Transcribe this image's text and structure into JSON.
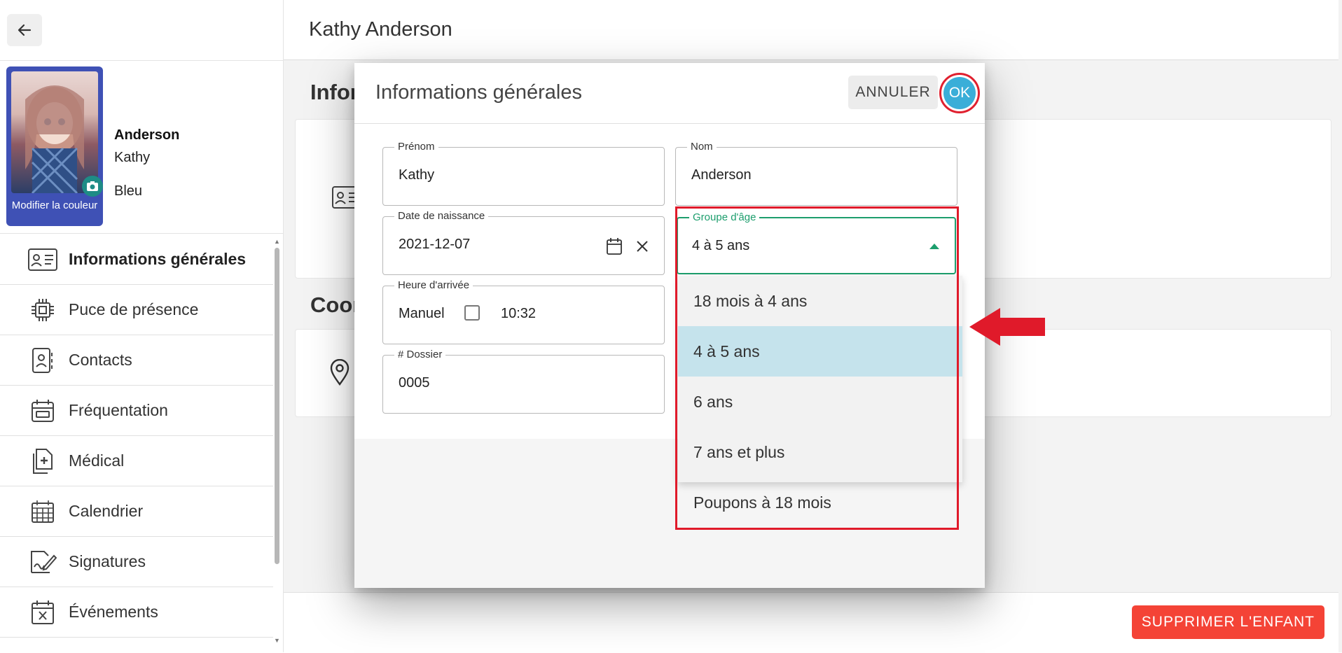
{
  "header": {
    "title": "Kathy Anderson"
  },
  "profile": {
    "last_name": "Anderson",
    "first_name": "Kathy",
    "color": "Bleu",
    "avatar_caption": "Modifier la couleur"
  },
  "sidebar": {
    "items": [
      {
        "label": "Informations générales",
        "icon": "id-card-icon",
        "active": true
      },
      {
        "label": "Puce de présence",
        "icon": "chip-icon",
        "active": false
      },
      {
        "label": "Contacts",
        "icon": "contact-book-icon",
        "active": false
      },
      {
        "label": "Fréquentation",
        "icon": "calendar-frame-icon",
        "active": false
      },
      {
        "label": "Médical",
        "icon": "medical-doc-icon",
        "active": false
      },
      {
        "label": "Calendrier",
        "icon": "calendar-grid-icon",
        "active": false
      },
      {
        "label": "Signatures",
        "icon": "signature-icon",
        "active": false
      },
      {
        "label": "Événements",
        "icon": "event-cancel-icon",
        "active": false
      }
    ]
  },
  "main": {
    "section1": "Infor",
    "section2": "Coor",
    "delete_label": "SUPPRIMER L'ENFANT"
  },
  "modal": {
    "title": "Informations générales",
    "cancel_label": "ANNULER",
    "ok_label": "OK",
    "fields": {
      "prenom": {
        "label": "Prénom",
        "value": "Kathy"
      },
      "nom": {
        "label": "Nom",
        "value": "Anderson"
      },
      "naissance": {
        "label": "Date de naissance",
        "value": "2021-12-07"
      },
      "groupe": {
        "label": "Groupe d'âge",
        "value": "4 à 5 ans"
      },
      "arrivee": {
        "label": "Heure d'arrivée",
        "mode": "Manuel",
        "time": "10:32"
      },
      "dossier": {
        "label": "# Dossier",
        "value": "0005"
      }
    },
    "age_options": [
      "18 mois à 4 ans",
      "4 à 5 ans",
      "6 ans",
      "7 ans et plus",
      "Poupons à 18 mois"
    ],
    "selected_option_index": 1
  },
  "colors": {
    "accent_focus": "#1d9e6d",
    "ok_button": "#3aaed8",
    "delete_button": "#f44336",
    "highlight": "#e01a2a",
    "avatar_card": "#3f51b5"
  }
}
